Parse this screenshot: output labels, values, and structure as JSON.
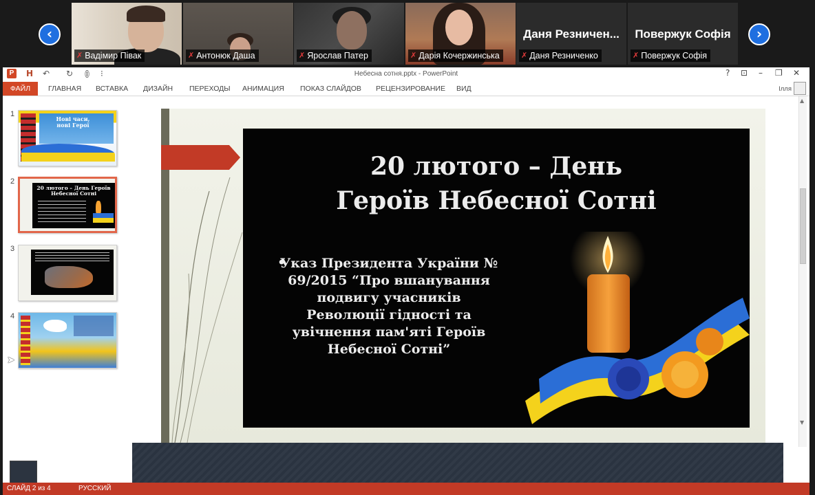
{
  "participants": [
    {
      "label": "Вадімир Півак",
      "video": true
    },
    {
      "label": "Антонюк Даша",
      "video": true
    },
    {
      "label": "Ярослав Патер",
      "video": true
    },
    {
      "label": "Дарія Кочержинська",
      "video": true
    },
    {
      "label": "Даня Резниченко",
      "display_name": "Даня  Резничен...",
      "video": false
    },
    {
      "label": "Повержук Софія",
      "display_name": "Повержук Софія",
      "video": false
    }
  ],
  "nav": {
    "prev_icon": "‹",
    "next_icon": "›"
  },
  "mic_off_icon": "✗",
  "powerpoint": {
    "window_title": "Небесна сотня.pptx - PowerPoint",
    "app_logo": "P",
    "quick_access": {
      "save_icon": "H",
      "undo_icon": "↶",
      "redo_icon": "↻",
      "slideshow_icon": "ꂦ",
      "more_icon": "⁝"
    },
    "window_controls": {
      "help": "?",
      "restore_ribbon": "⊡",
      "minimize": "–",
      "maximize": "❐",
      "close": "✕"
    },
    "ribbon_tabs": [
      "ФАЙЛ",
      "ГЛАВНАЯ",
      "ВСТАВКА",
      "ДИЗАЙН",
      "ПЕРЕХОДЫ",
      "АНИМАЦИЯ",
      "ПОКАЗ СЛАЙДОВ",
      "РЕЦЕНЗИРОВАНИЕ",
      "ВИД"
    ],
    "user_name": "Ілля",
    "thumbnails": [
      {
        "number": "1",
        "text": "Нові часи, нові Герої"
      },
      {
        "number": "2",
        "text": "20 лютого – День Героїв Небесної Сотні"
      },
      {
        "number": "3",
        "text": ""
      },
      {
        "number": "4",
        "text": ""
      }
    ],
    "active_slide": 2,
    "slide": {
      "title_line1": "20 лютого – День",
      "title_line2": "Героїв Небесної Сотні",
      "bullet": "•",
      "body": "Указ Президента України № 69/2015 “Про вшанування подвигу учасників Революції гідності та увічнення пам'яті Героїв Небесної Сотні”"
    },
    "status_bar": {
      "slide_info": "СЛАЙД 2 из 4",
      "language": "РУССКИЙ"
    }
  },
  "colors": {
    "zoom_bg": "#1a1a1a",
    "zoom_blue": "#1f6fe0",
    "ppt_accent": "#d24726",
    "slide_red": "#c23a26",
    "ukraine_blue": "#2b6ed6",
    "ukraine_yellow": "#f4d21c"
  }
}
